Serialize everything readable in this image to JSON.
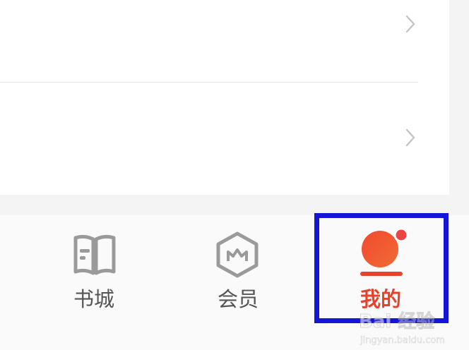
{
  "list": {
    "rows": [
      {
        "chevron_icon": "chevron-right-icon"
      },
      {
        "chevron_icon": "chevron-right-icon"
      }
    ]
  },
  "tabbar": {
    "tabs": [
      {
        "label": "书城",
        "icon": "book-icon",
        "active": false
      },
      {
        "label": "会员",
        "icon": "crown-hexagon-icon",
        "active": false
      },
      {
        "label": "我的",
        "icon": "profile-dot-icon",
        "active": true
      }
    ]
  },
  "colors": {
    "active": "#e8412c",
    "inactive": "#555555",
    "icon_gray": "#9a9a9a",
    "highlight": "#1515d8"
  },
  "watermark": {
    "brand": "Bai 经验",
    "url": "jingyan.baidu.com"
  }
}
